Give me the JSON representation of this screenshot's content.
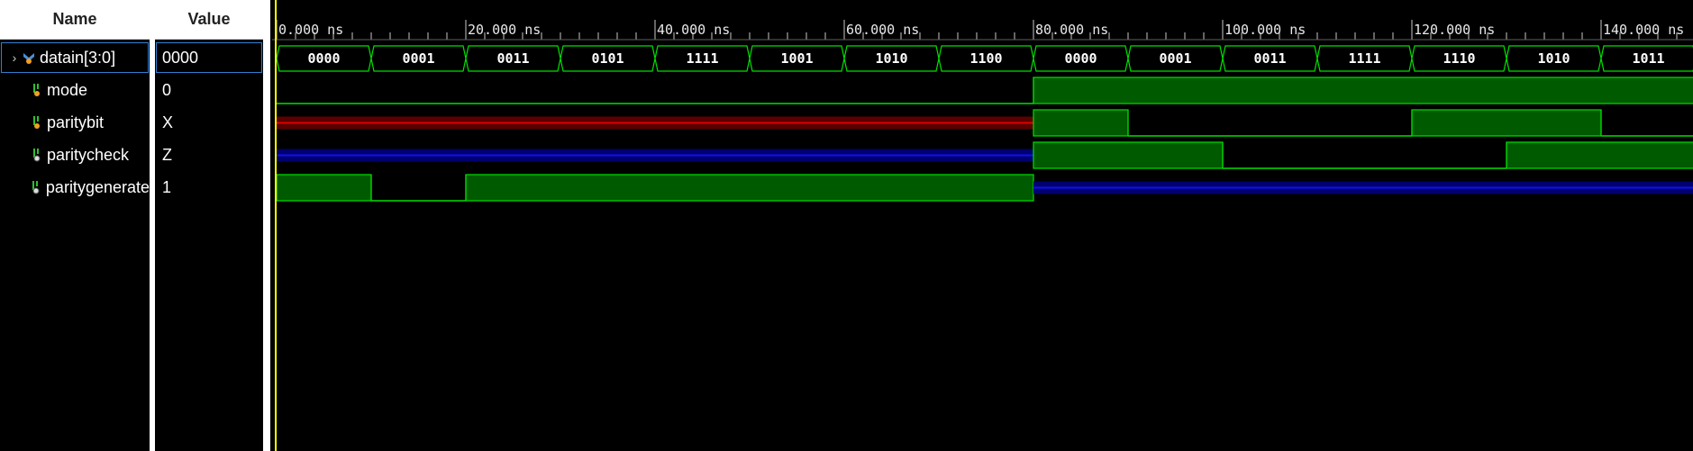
{
  "headers": {
    "name": "Name",
    "value": "Value"
  },
  "signals": [
    {
      "name": "datain[3:0]",
      "value": "0000",
      "icon": "bus-icon",
      "expandable": true,
      "selected": true
    },
    {
      "name": "mode",
      "value": "0",
      "icon": "input-signal-icon"
    },
    {
      "name": "paritybit",
      "value": "X",
      "icon": "input-signal-icon"
    },
    {
      "name": "paritycheck",
      "value": "Z",
      "icon": "output-signal-icon"
    },
    {
      "name": "paritygenerate",
      "value": "1",
      "icon": "output-signal-icon"
    }
  ],
  "time_ticks": [
    "0.000 ns",
    "20.000 ns",
    "40.000 ns",
    "60.000 ns",
    "80.000 ns",
    "100.000 ns",
    "120.000 ns",
    "140.000 ns"
  ],
  "waveform": {
    "time_range_ns": [
      0,
      150
    ],
    "cursor_ns": 0,
    "datain_values": [
      "0000",
      "0001",
      "0011",
      "0101",
      "1111",
      "1001",
      "1010",
      "1100",
      "0000",
      "0001",
      "0011",
      "1111",
      "1110",
      "1010",
      "1011"
    ],
    "segment_ns": 10,
    "digital": {
      "mode": [
        {
          "t0": 0,
          "t1": 80,
          "v": "0"
        },
        {
          "t0": 80,
          "t1": 150,
          "v": "1"
        }
      ],
      "paritybit": [
        {
          "t0": 0,
          "t1": 80,
          "v": "X"
        },
        {
          "t0": 80,
          "t1": 90,
          "v": "1"
        },
        {
          "t0": 90,
          "t1": 120,
          "v": "0"
        },
        {
          "t0": 120,
          "t1": 140,
          "v": "1"
        },
        {
          "t0": 140,
          "t1": 150,
          "v": "0"
        }
      ],
      "paritycheck": [
        {
          "t0": 0,
          "t1": 80,
          "v": "Z"
        },
        {
          "t0": 80,
          "t1": 100,
          "v": "1"
        },
        {
          "t0": 100,
          "t1": 130,
          "v": "0"
        },
        {
          "t0": 130,
          "t1": 150,
          "v": "1"
        }
      ],
      "paritygenerate": [
        {
          "t0": 0,
          "t1": 10,
          "v": "1"
        },
        {
          "t0": 10,
          "t1": 20,
          "v": "0"
        },
        {
          "t0": 20,
          "t1": 80,
          "v": "1"
        },
        {
          "t0": 80,
          "t1": 150,
          "v": "Z"
        }
      ]
    }
  },
  "colors": {
    "green": "#00e000",
    "green_fill": "#005a00",
    "red_x": "#e00000",
    "red_fill": "#5a0000",
    "blue_z": "#1010f0",
    "blue_fill": "#000070",
    "cursor": "#ffff00",
    "bus_text": "#ffffff"
  }
}
